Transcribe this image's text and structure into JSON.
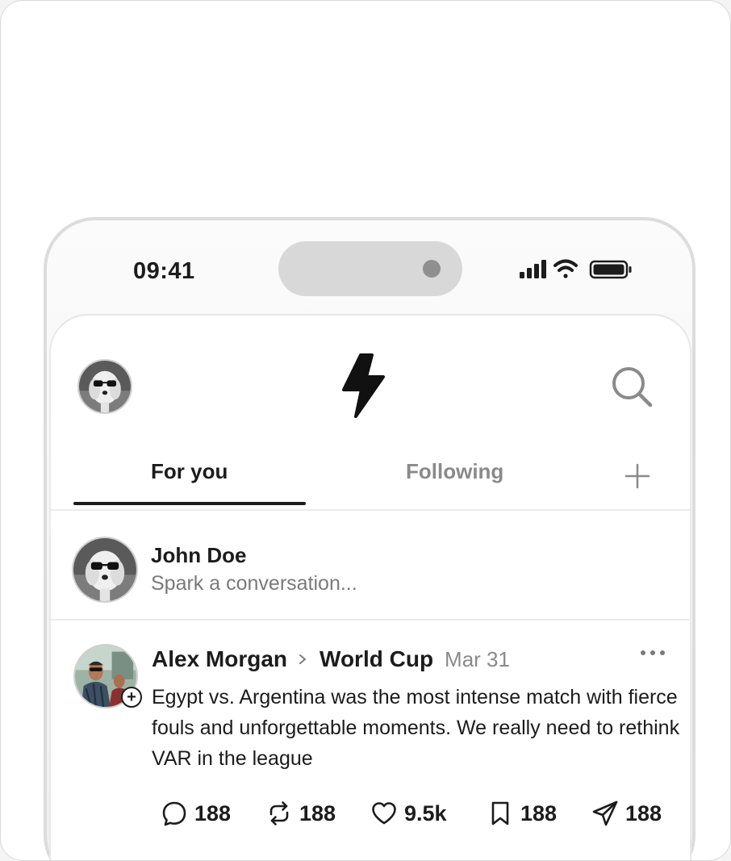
{
  "status_bar": {
    "time": "09:41"
  },
  "header": {
    "logo_icon": "lightning-bolt-icon",
    "search_icon": "search-icon"
  },
  "tabs": [
    {
      "label": "For you",
      "selected": true
    },
    {
      "label": "Following",
      "selected": false
    }
  ],
  "compose": {
    "name": "John Doe",
    "placeholder": "Spark a conversation..."
  },
  "post": {
    "author": "Alex Morgan",
    "community": "World Cup",
    "date": "Mar 31",
    "text": "Egypt vs. Argentina was the most intense match with fierce fouls and unforgettable moments. We really need to rethink VAR in the league",
    "actions": {
      "comments": "188",
      "reposts": "188",
      "likes": "9.5k",
      "bookmarks": "188",
      "shares": "188"
    }
  },
  "colors": {
    "text_primary": "#1c1c1c",
    "text_secondary": "#8a8a8a",
    "divider": "#ececec"
  }
}
